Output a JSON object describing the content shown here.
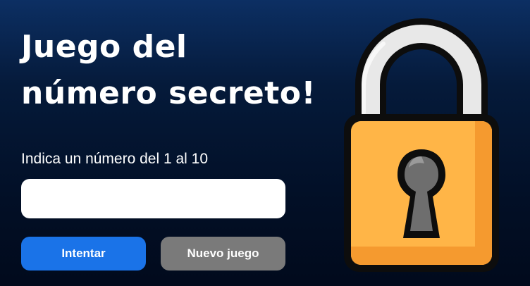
{
  "page": {
    "title_line1": "Juego del",
    "title_line2": "número secreto!",
    "prompt": "Indica un número del 1 al 10",
    "input_value": "",
    "try_button": "Intentar",
    "new_game_button": "Nuevo juego"
  },
  "illustration": {
    "name": "padlock-icon",
    "colors": {
      "body": "#ffb547",
      "body_shadow": "#f59a2f",
      "shackle": "#e8e8e8",
      "outline": "#0d0d0d",
      "keyhole": "#6e6e6e"
    }
  },
  "colors": {
    "primary_button": "#1a73e8",
    "secondary_button": "#7a7a7a"
  }
}
